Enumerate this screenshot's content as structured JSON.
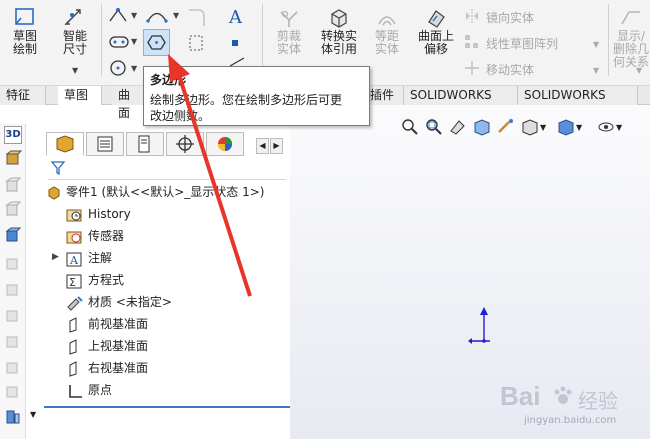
{
  "ribbon": {
    "sketch_label": "草图绘制",
    "smart_dim_label": "智能尺寸",
    "trim_label": "剪裁实体",
    "convert_label": "转换实体引用",
    "offset_label": "等距实体",
    "surface_offset_label": "曲面上偏移",
    "mirror_label": "镜向实体",
    "linear_pattern_label": "线性草图阵列",
    "move_label": "移动实体",
    "display_label": "显示/删除几何关系"
  },
  "tabs": [
    {
      "label": "特征"
    },
    {
      "label": "草图"
    },
    {
      "label": "曲面"
    },
    {
      "label": "插件"
    },
    {
      "label": "SOLIDWORKS MBD"
    },
    {
      "label": "SOLIDWORKS CAM"
    }
  ],
  "tooltip": {
    "title": "多边形",
    "desc_line1": "绘制多边形。您在绘制多边形后可更",
    "desc_line2": "改边侧数。"
  },
  "tree": {
    "root": "零件1  (默认<<默认>_显示状态 1>)",
    "items": [
      {
        "label": "History"
      },
      {
        "label": "传感器"
      },
      {
        "label": "注解"
      },
      {
        "label": "方程式"
      },
      {
        "label": "材质 <未指定>"
      },
      {
        "label": "前视基准面"
      },
      {
        "label": "上视基准面"
      },
      {
        "label": "右视基准面"
      },
      {
        "label": "原点"
      }
    ]
  },
  "left_toolbar": {
    "label_3d": "3D"
  },
  "watermark": {
    "brand": "Bai",
    "brand_suffix": "经验",
    "url": "jingyan.baidu.com"
  },
  "colors": {
    "accent_blue": "#3c78c8",
    "arrow_red": "#e8352a",
    "origin_blue": "#1f1fcf"
  }
}
